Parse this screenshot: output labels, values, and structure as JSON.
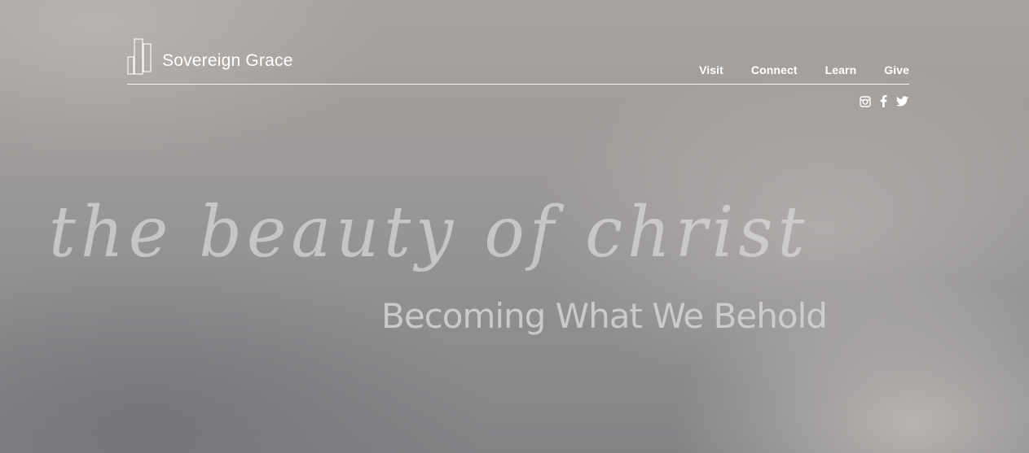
{
  "header": {
    "brand_name": "Sovereign Grace",
    "nav": [
      {
        "label": "Visit"
      },
      {
        "label": "Connect"
      },
      {
        "label": "Learn"
      },
      {
        "label": "Give"
      }
    ],
    "social": [
      "instagram-icon",
      "facebook-icon",
      "twitter-icon"
    ]
  },
  "hero": {
    "script_title": "the beauty of christ",
    "subtitle": "Becoming What We Behold"
  },
  "colors": {
    "text": "#ffffff",
    "hero_text": "#d8d6d6",
    "background": "#9d9a99"
  }
}
